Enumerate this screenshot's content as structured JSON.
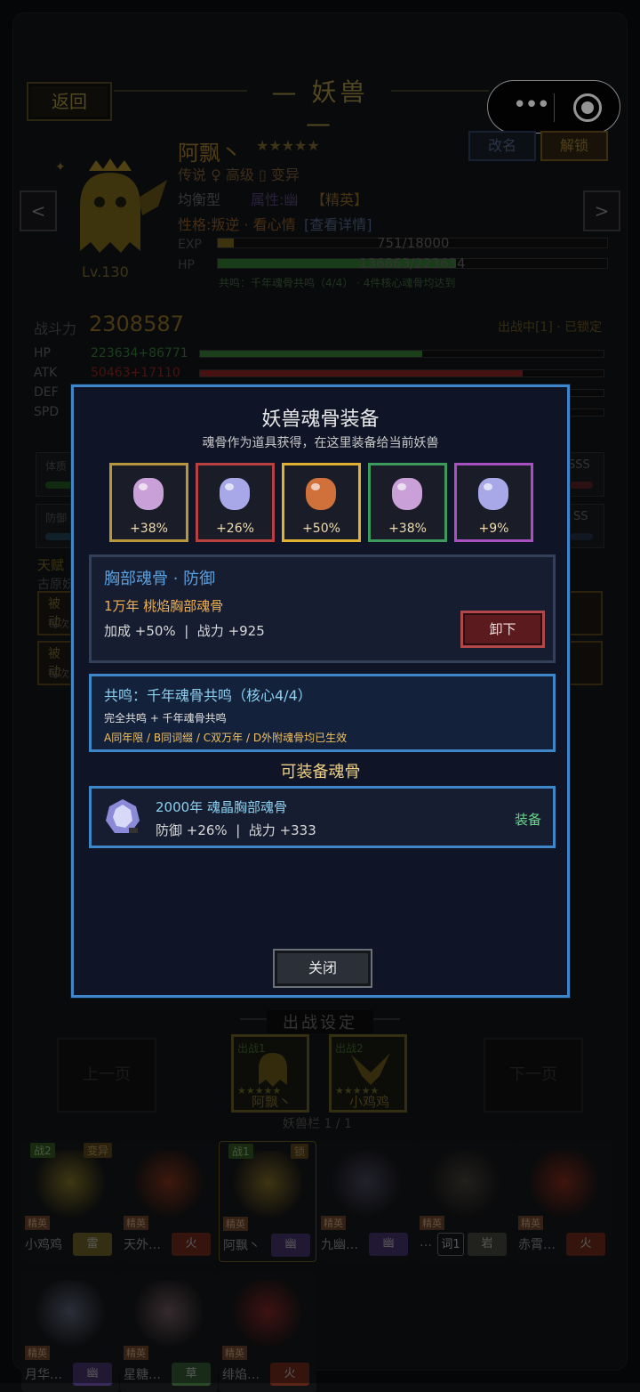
{
  "header": {
    "back": "返回",
    "title": "妖兽",
    "rename": "改名",
    "unlock": "解锁",
    "prev": "<",
    "next": ">"
  },
  "pet": {
    "name": "阿飘丶",
    "stars": "★★★★★",
    "line1": "传说 ♀ 高级 ▯ 变异",
    "line2a": "均衡型",
    "line2b": "属性:幽",
    "line2c": "【精英】",
    "line3a": "性格:叛逆 · 看心情",
    "line3b": "[查看详情]",
    "level": "Lv.130",
    "exp_label": "EXP",
    "exp_value": "751/18000",
    "exp_fraction": 0.042,
    "hp_label": "HP",
    "hp_value": "136863/223634",
    "hp_fraction": 0.612,
    "resonance_note": "共鸣：千年魂骨共鸣（4/4） · 4件核心魂骨均达到"
  },
  "combat": {
    "label": "战斗力",
    "value": "2308587",
    "status": "出战中[1] · 已锁定",
    "stats": [
      {
        "k": "HP",
        "v": "223634+86771",
        "color": "#2f6b2f",
        "fraction": 0.55
      },
      {
        "k": "ATK",
        "v": "50463+17110",
        "color": "#7a2020",
        "fraction": 0.8
      },
      {
        "k": "DEF",
        "v": "",
        "color": "#333",
        "fraction": 0
      },
      {
        "k": "SPD",
        "v": "",
        "color": "#333",
        "fraction": 0
      }
    ]
  },
  "bg_fragments": {
    "b1": "体质",
    "b2": "防御",
    "sss": "SSS",
    "ss": "SS",
    "t1": "天赋",
    "t2": "古原妖",
    "p1": "被动",
    "p2": "每次",
    "p3": "被动",
    "p4": "每次"
  },
  "modal": {
    "title": "妖兽魂骨装备",
    "subtitle": "魂骨作为道具获得，在这里装备给当前妖兽",
    "slots": [
      {
        "bonus": "+38%",
        "border": "#b8963c",
        "gem": "#c9a0d8"
      },
      {
        "bonus": "+26%",
        "border": "#b84040",
        "gem": "#a8a8e8"
      },
      {
        "bonus": "+50%",
        "border": "#e0b030",
        "gem": "#d0703a"
      },
      {
        "bonus": "+38%",
        "border": "#3c9a5c",
        "gem": "#c9a0d8"
      },
      {
        "bonus": "+9%",
        "border": "#a850c0",
        "gem": "#a8a8e8"
      }
    ],
    "selected": {
      "title": "胸部魂骨 · 防御",
      "item": "1万年 桃焰胸部魂骨",
      "stats": "加成 +50%  |  战力 +925",
      "unequip": "卸下"
    },
    "resonance": {
      "title": "共鸣：千年魂骨共鸣（核心4/4）",
      "line1": "完全共鸣 + 千年魂骨共鸣",
      "line2": "A同年限 / B同词缀 / C双万年 / D外附魂骨均已生效"
    },
    "available_title": "可装备魂骨",
    "available": [
      {
        "name": "2000年 魂晶胸部魂骨",
        "stats": "防御 +26%  |  战力 +333",
        "action": "装备"
      }
    ],
    "close": "关闭"
  },
  "deploy": {
    "title": "出战设定",
    "prev_page": "上一页",
    "next_page": "下一页",
    "slot1_tag": "出战1",
    "slot1_name": "阿飘丶",
    "slot2_tag": "出战2",
    "slot2_name": "小鸡鸡",
    "slot_stars": "★★★★★",
    "page_info": "妖兽栏 1 / 1"
  },
  "roster": [
    {
      "name": "小鸡鸡",
      "tag": "雷",
      "elite": "精英",
      "corner": "战2",
      "corner2": "变异",
      "tagColor": "#5a5020",
      "art": "#6a6020"
    },
    {
      "name": "天外…",
      "tag": "火",
      "elite": "精英",
      "corner": "",
      "corner2": "",
      "tagColor": "#5a2418",
      "art": "#6a2a18"
    },
    {
      "name": "阿飘丶",
      "tag": "幽",
      "elite": "精英",
      "corner": "战1",
      "corner2": "锁",
      "tagColor": "#3a2a5a",
      "art": "#6a5a20"
    },
    {
      "name": "九幽…",
      "tag": "幽",
      "elite": "精英",
      "corner": "",
      "corner2": "",
      "tagColor": "#3a2a5a",
      "art": "#3a3a4a"
    },
    {
      "name": "…",
      "tag": "岩",
      "elite": "精英",
      "corner": "",
      "corner2": "",
      "tagColor": "#3a3a34",
      "art": "#3a3630",
      "extra": "词1"
    },
    {
      "name": "赤霄…",
      "tag": "火",
      "elite": "精英",
      "corner": "",
      "corner2": "",
      "tagColor": "#5a2418",
      "art": "#6a2418"
    },
    {
      "name": "月华…",
      "tag": "幽",
      "elite": "精英",
      "corner": "",
      "corner2": "",
      "tagColor": "#3a2a5a",
      "art": "#4a5060"
    },
    {
      "name": "星糖…",
      "tag": "草",
      "elite": "精英",
      "corner": "",
      "corner2": "",
      "tagColor": "#2a4a2a",
      "art": "#5a4a50"
    },
    {
      "name": "绯焰…",
      "tag": "火",
      "elite": "精英",
      "corner": "",
      "corner2": "",
      "tagColor": "#5a2418",
      "art": "#6a2020"
    }
  ]
}
